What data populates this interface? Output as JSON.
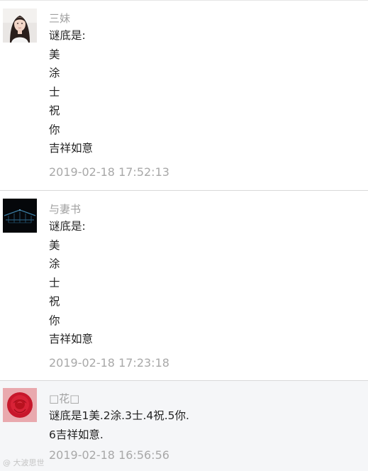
{
  "comments": [
    {
      "name": "三妹",
      "lines": [
        "谜底是:",
        "美",
        "涂",
        "士",
        "祝",
        "你",
        "吉祥如意"
      ],
      "time": "2019-02-18 17:52:13",
      "avatar": "woman-portrait-avatar"
    },
    {
      "name": "与妻书",
      "lines": [
        "谜底是:",
        "美",
        "涂",
        "士",
        "祝",
        "你",
        "吉祥如意"
      ],
      "time": "2019-02-18 17:23:18",
      "avatar": "dark-bridge-avatar"
    },
    {
      "name": "□花□",
      "lines": [
        "谜底是1美.2涂.3士.4祝.5你.",
        "6吉祥如意."
      ],
      "time": "2019-02-18 16:56:56",
      "avatar": "red-rose-avatar"
    }
  ],
  "watermark": "@ 大波思世",
  "colors": {
    "name": "#a0a0a0",
    "text": "#222222",
    "time": "#a8a8a8",
    "divider": "#d9d9d9",
    "highlight_row_bg": "#f5f6f8"
  }
}
